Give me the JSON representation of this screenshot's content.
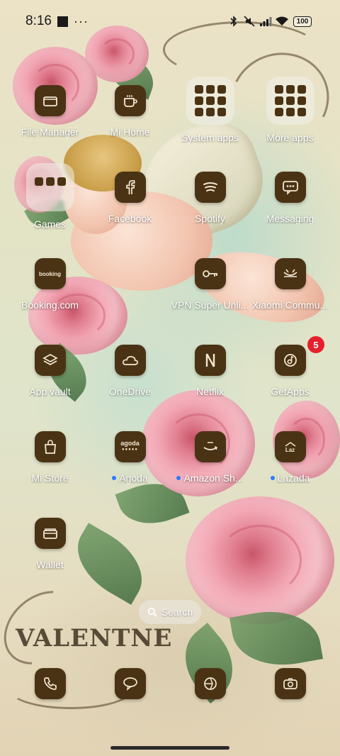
{
  "status_bar": {
    "time": "8:16",
    "more_indicator": "···",
    "battery": "100",
    "icons": [
      "bluetooth-icon",
      "mute-icon",
      "signal-icon",
      "wifi-icon"
    ]
  },
  "apps": [
    {
      "label": "File Manager",
      "icon": "folder-file-icon"
    },
    {
      "label": "Mi Home",
      "icon": "cup-icon"
    },
    {
      "label": "System apps",
      "icon": "folder-group-icon"
    },
    {
      "label": "More apps",
      "icon": "folder-group-icon"
    },
    {
      "label": "Games",
      "icon": "folder-group-icon"
    },
    {
      "label": "Facebook",
      "icon": "facebook-icon"
    },
    {
      "label": "Spotify",
      "icon": "spotify-icon"
    },
    {
      "label": "Messaging",
      "icon": "message-icon"
    },
    {
      "label": "Booking.com",
      "icon": "booking-icon",
      "icon_text": "booking"
    },
    {
      "label": "",
      "icon": ""
    },
    {
      "label": "VPN Super Unli...",
      "icon": "key-icon"
    },
    {
      "label": "Xiaomi Commu...",
      "icon": "xiaomi-community-icon"
    },
    {
      "label": "App vault",
      "icon": "layers-icon"
    },
    {
      "label": "OneDrive",
      "icon": "cloud-icon"
    },
    {
      "label": "Netflix",
      "icon": "netflix-icon"
    },
    {
      "label": "GetApps",
      "icon": "getapps-icon",
      "badge": "5"
    },
    {
      "label": "Mi Store",
      "icon": "shopping-bag-icon"
    },
    {
      "label": "Agoda",
      "icon": "agoda-icon",
      "icon_text": "agoda",
      "new": true
    },
    {
      "label": "Amazon Sh...",
      "icon": "amazon-icon",
      "new": true
    },
    {
      "label": "Lazada",
      "icon": "lazada-icon",
      "icon_text": "Laz",
      "new": true
    },
    {
      "label": "Wallet",
      "icon": "wallet-icon"
    }
  ],
  "search": {
    "label": "Search"
  },
  "dock": [
    {
      "name": "phone",
      "icon": "phone-icon"
    },
    {
      "name": "messages",
      "icon": "chat-bubble-icon"
    },
    {
      "name": "browser",
      "icon": "browser-icon"
    },
    {
      "name": "camera",
      "icon": "camera-icon"
    }
  ],
  "colors": {
    "icon_bg": "#4a3314",
    "icon_fg": "#f2e7d3",
    "badge": "#e6202c",
    "new_dot": "#2b7bff"
  }
}
